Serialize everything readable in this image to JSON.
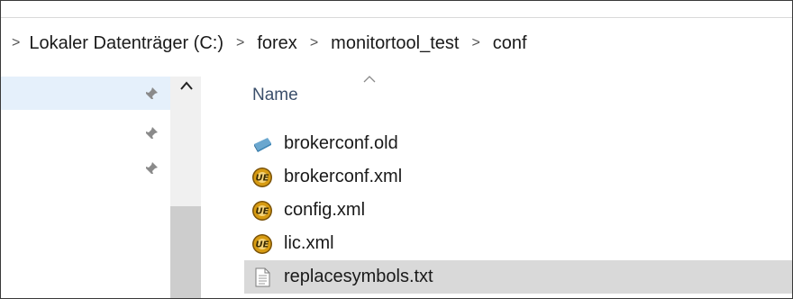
{
  "breadcrumb": {
    "items": [
      "Lokaler Datenträger (C:)",
      "forex",
      "monitortool_test",
      "conf"
    ],
    "separator": ">"
  },
  "column_header": {
    "label": "Name",
    "sort": "ascending"
  },
  "files": [
    {
      "name": "brokerconf.old",
      "icon": "old-file-icon",
      "selected": false
    },
    {
      "name": "brokerconf.xml",
      "icon": "ultraedit-icon",
      "selected": false
    },
    {
      "name": "config.xml",
      "icon": "ultraedit-icon",
      "selected": false
    },
    {
      "name": "lic.xml",
      "icon": "ultraedit-icon",
      "selected": false
    },
    {
      "name": "replacesymbols.txt",
      "icon": "text-file-icon",
      "selected": true
    }
  ],
  "colors": {
    "nav_selected": "#e5f0fb",
    "row_selected": "#d9d9d9",
    "header_text": "#3b4f6b",
    "ultraedit_gold": "#d79b12"
  }
}
